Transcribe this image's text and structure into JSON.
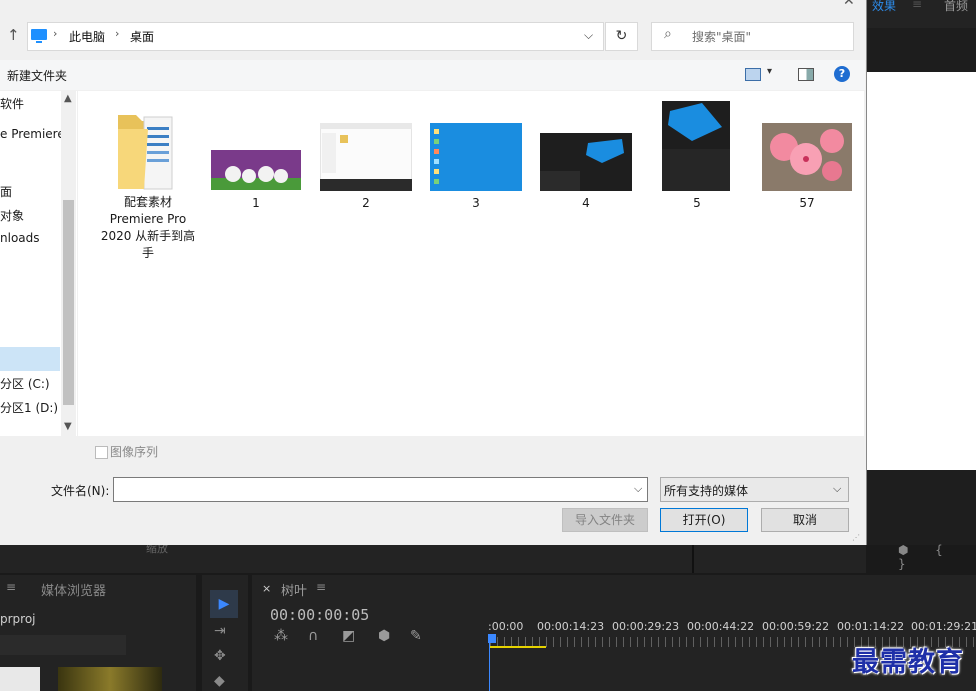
{
  "premiere": {
    "top_tabs": {
      "effects": "效果",
      "sep": "≡",
      "first": "首频"
    },
    "project_panel": {
      "menu": "≡",
      "tab_label": "媒体浏览器",
      "file_label": "prproj"
    },
    "scale_label": "缩放",
    "timeline": {
      "close": "×",
      "name": "树叶",
      "menu": "≡",
      "timecode": "00:00:00:05",
      "ruler_labels": [
        ":00:00",
        "00:00:14:23",
        "00:00:29:23",
        "00:00:44:22",
        "00:00:59:22",
        "00:01:14:22",
        "00:01:29:21"
      ]
    },
    "watermark": "最需教育"
  },
  "dialog": {
    "close": "✕",
    "up_arrow": "↑",
    "breadcrumb": [
      "此电脑",
      "桌面"
    ],
    "breadcrumb_sep": "›",
    "addr_chevron": "⌵",
    "refresh": "↻",
    "search_icon": "⌕",
    "search_placeholder": "搜索\"桌面\"",
    "toolbar": {
      "new_folder": "新建文件夹",
      "view_chevron": "▾",
      "help": "?"
    },
    "sidebar": {
      "up": "▲",
      "down": "▼",
      "items": [
        "软件",
        "e Premiere",
        "面",
        "对象",
        "nloads",
        "分区 (C:)",
        "分区1 (D:)"
      ]
    },
    "files": [
      {
        "label": "配套素材\nPremiere Pro\n2020 从新手到高\n手",
        "icon": "folder-icon"
      },
      {
        "label": "1",
        "icon": "image-thumbnail"
      },
      {
        "label": "2",
        "icon": "image-thumbnail"
      },
      {
        "label": "3",
        "icon": "image-thumbnail"
      },
      {
        "label": "4",
        "icon": "image-thumbnail"
      },
      {
        "label": "5",
        "icon": "image-thumbnail"
      },
      {
        "label": "57",
        "icon": "image-thumbnail"
      }
    ],
    "image_sequence_label": "图像序列",
    "filename_label": "文件名(N):",
    "filename_value": "",
    "filetype_value": "所有支持的媒体",
    "buttons": {
      "import_folder": "导入文件夹",
      "open": "打开(O)",
      "cancel": "取消"
    }
  }
}
